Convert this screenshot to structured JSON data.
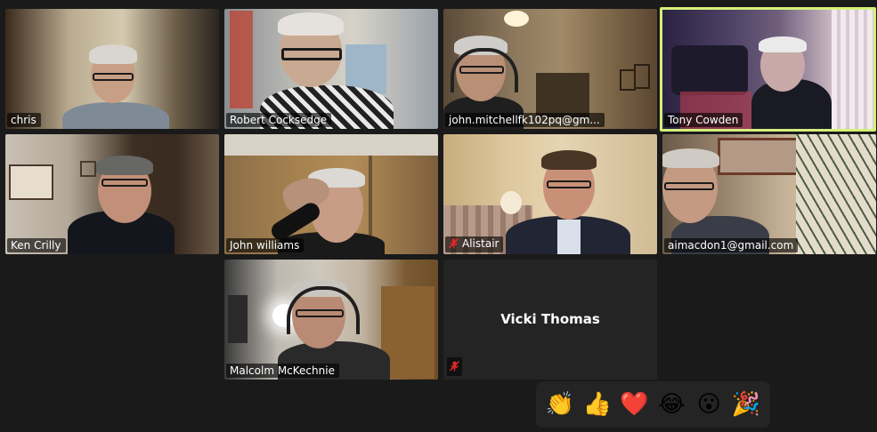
{
  "participants": [
    {
      "name": "chris"
    },
    {
      "name": "Robert Cocksedge"
    },
    {
      "name": "john.mitchellfk102pq@gm..."
    },
    {
      "name": "Tony Cowden"
    },
    {
      "name": "Ken Crilly"
    },
    {
      "name": "John williams"
    },
    {
      "name": "Alistair",
      "muted": true
    },
    {
      "name": "aimacdon1@gmail.com"
    },
    {
      "name": "Malcolm McKechnie"
    },
    {
      "name": "Vicki Thomas",
      "muted": true,
      "video_off": true
    }
  ],
  "active_speaker": "Tony Cowden",
  "reactions": [
    {
      "emoji": "👏",
      "icon": "clap-icon"
    },
    {
      "emoji": "👍",
      "icon": "thumbs-up-icon"
    },
    {
      "emoji": "❤️",
      "icon": "heart-icon"
    },
    {
      "emoji": "😂",
      "icon": "joy-icon"
    },
    {
      "emoji": "😮",
      "icon": "surprised-icon"
    },
    {
      "emoji": "🎉",
      "icon": "party-icon"
    }
  ],
  "colors": {
    "background": "#1a1a1a",
    "active_border": "#d6f07a",
    "muted_red": "#e02828",
    "reaction_bar": "#242424"
  }
}
